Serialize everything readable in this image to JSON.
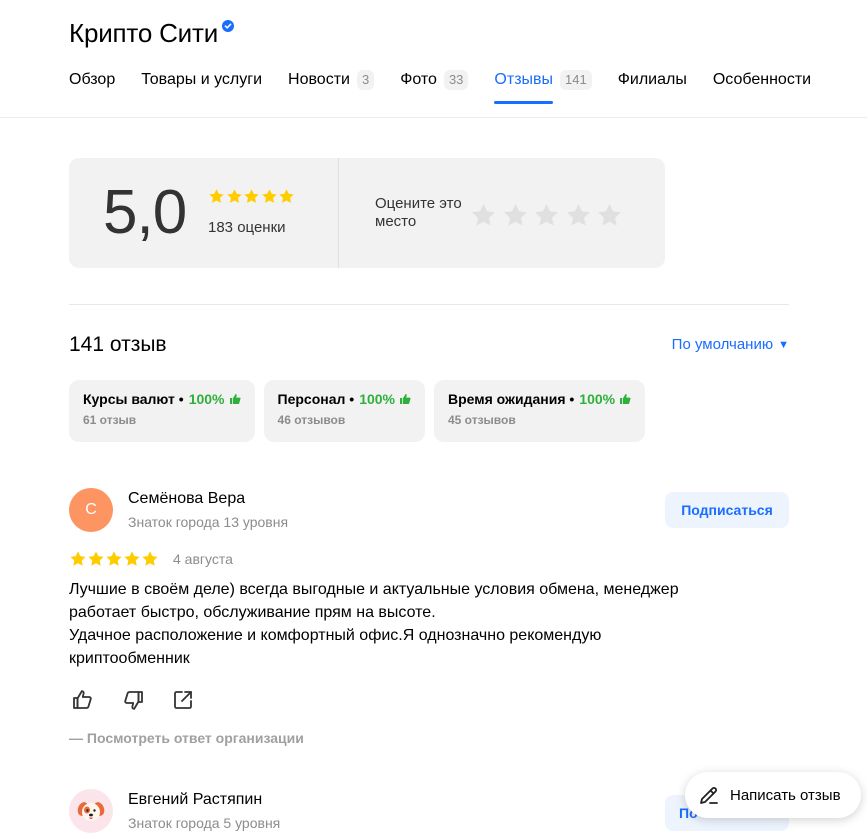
{
  "header": {
    "title": "Крипто Сити",
    "verified_icon": "verified-badge-icon"
  },
  "tabs": [
    {
      "label": "Обзор",
      "count": null
    },
    {
      "label": "Товары и услуги",
      "count": null
    },
    {
      "label": "Новости",
      "count": "3"
    },
    {
      "label": "Фото",
      "count": "33"
    },
    {
      "label": "Отзывы",
      "count": "141",
      "active": true
    },
    {
      "label": "Филиалы",
      "count": null
    },
    {
      "label": "Особенности",
      "count": null
    }
  ],
  "rating": {
    "value": "5,0",
    "stars": 5,
    "count_label": "183 оценки",
    "rate_prompt": "Оцените это место"
  },
  "reviews": {
    "title": "141 отзыв",
    "sort_label": "По умолчанию",
    "aspects": [
      {
        "label": "Курсы валют",
        "percent": "100%",
        "count": "61 отзыв"
      },
      {
        "label": "Персонал",
        "percent": "100%",
        "count": "46 отзывов"
      },
      {
        "label": "Время ожидания",
        "percent": "100%",
        "count": "45 отзывов"
      }
    ],
    "items": [
      {
        "initial": "С",
        "name": "Семёнова Вера",
        "level": "Знаток города 13 уровня",
        "subscribe_label": "Подписаться",
        "stars": 5,
        "date": "4 августа",
        "text_lines": [
          "Лучшие в своём деле) всегда выгодные и актуальные условия обмена, менеджер",
          "работает быстро, обслуживание прям на высоте.",
          "Удачное расположение и комфортный офис.Я однозначно рекомендую",
          "криптообменник"
        ],
        "org_reply_label": "— Посмотреть ответ организации"
      },
      {
        "name": "Евгений Растяпин",
        "level": "Знаток города 5 уровня",
        "subscribe_label": "По"
      }
    ]
  },
  "write_review_label": "Написать отзыв",
  "colors": {
    "accent": "#196dff",
    "star": "#fc0",
    "star_empty": "#e0e0e0",
    "positive": "#2fb03d",
    "avatar_1": "#fd9562"
  }
}
